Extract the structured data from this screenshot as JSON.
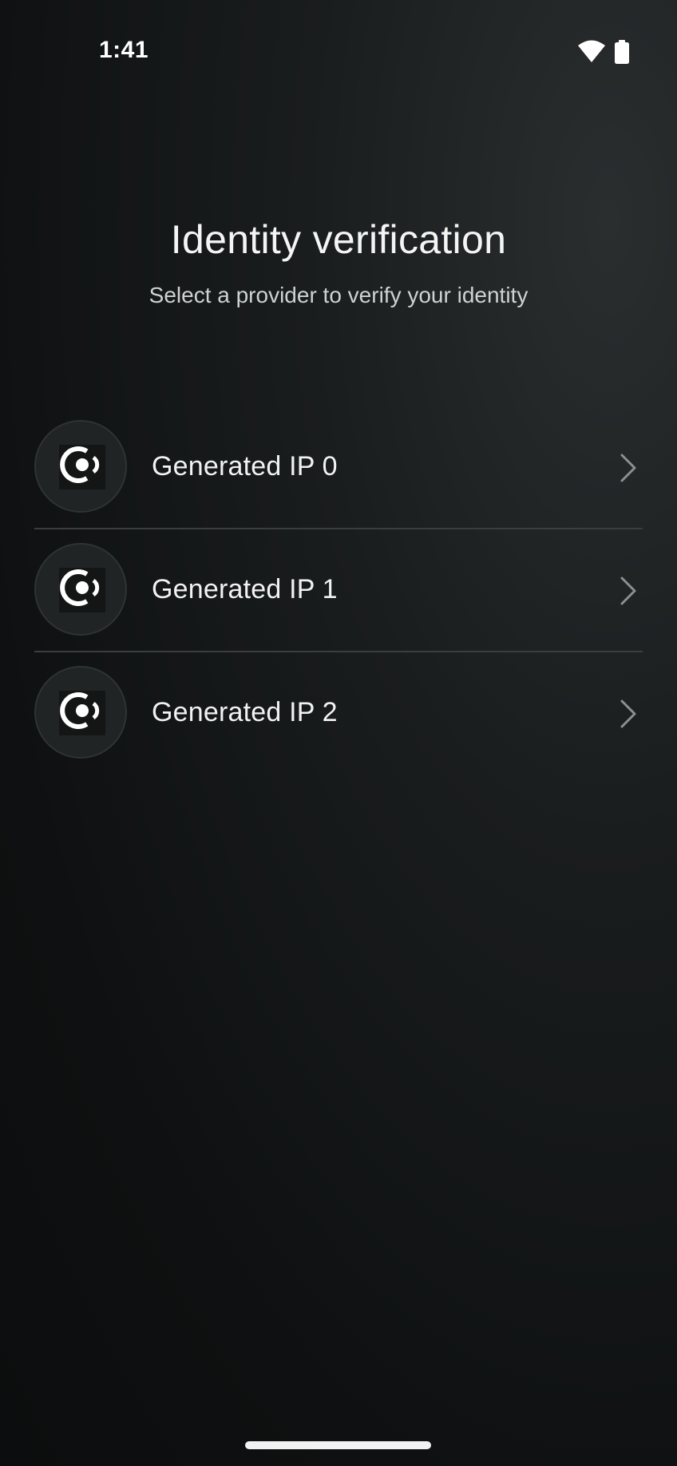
{
  "status_bar": {
    "time": "1:41",
    "icons": [
      "wifi-icon",
      "battery-icon"
    ]
  },
  "header": {
    "title": "Identity verification",
    "subtitle": "Select a provider to verify your identity"
  },
  "providers": [
    {
      "name": "Generated IP 0",
      "icon": "provider-logo-icon"
    },
    {
      "name": "Generated IP 1",
      "icon": "provider-logo-icon"
    },
    {
      "name": "Generated IP 2",
      "icon": "provider-logo-icon"
    }
  ],
  "colors": {
    "background": "#121415",
    "text_primary": "#f2f2f2",
    "text_secondary": "#cfd2d3",
    "divider": "#3a3e40",
    "logo_circle": "#202425"
  }
}
